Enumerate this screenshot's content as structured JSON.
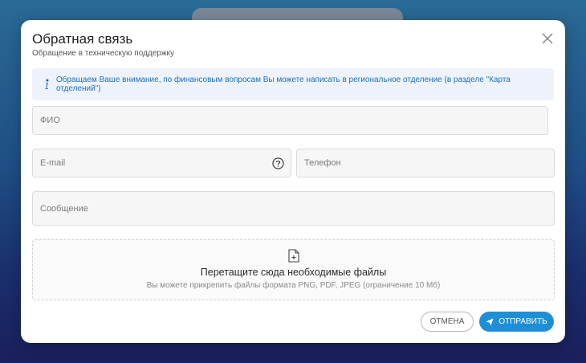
{
  "modal": {
    "title": "Обратная связь",
    "subtitle": "Обращение в техническую поддержку",
    "notice": "Обращаем Ваше внимание, по финансовым вопросам Вы можете написать в региональное отделение (в разделе \"Карта отделений\")",
    "fields": {
      "fio_placeholder": "ФИО",
      "email_placeholder": "E-mail",
      "phone_placeholder": "Телефон",
      "message_placeholder": "Сообщение"
    },
    "dropzone": {
      "title": "Перетащите сюда необходимые файлы",
      "hint": "Вы можете прикрепить файлы формата PNG, PDF, JPEG (ограничение 10 Мб)"
    },
    "buttons": {
      "cancel": "ОТМЕНА",
      "send": "ОТПРАВИТЬ"
    }
  },
  "icons": {
    "close": "close-icon",
    "info": "info-icon",
    "help": "question-circle-icon",
    "file_add": "file-add-icon",
    "send": "paper-plane-icon"
  },
  "colors": {
    "accent": "#1e8fd6",
    "notice_text": "#1f6fb8",
    "notice_bg": "#eef3fb"
  }
}
